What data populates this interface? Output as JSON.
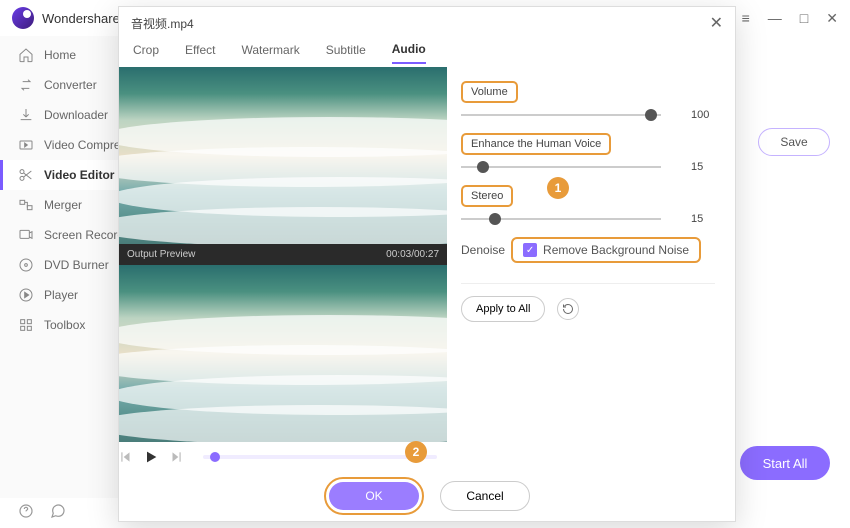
{
  "app": {
    "name": "Wondershare"
  },
  "window_controls": {
    "menu": "≡",
    "minimize": "—",
    "maximize": "□",
    "close": "✕"
  },
  "sidebar": {
    "items": [
      {
        "id": "home",
        "label": "Home"
      },
      {
        "id": "converter",
        "label": "Converter"
      },
      {
        "id": "downloader",
        "label": "Downloader"
      },
      {
        "id": "compress",
        "label": "Video Compress"
      },
      {
        "id": "editor",
        "label": "Video Editor"
      },
      {
        "id": "merger",
        "label": "Merger"
      },
      {
        "id": "recorder",
        "label": "Screen Recorde"
      },
      {
        "id": "burner",
        "label": "DVD Burner"
      },
      {
        "id": "player",
        "label": "Player"
      },
      {
        "id": "toolbox",
        "label": "Toolbox"
      }
    ]
  },
  "buttons": {
    "save": "Save",
    "start_all": "Start All",
    "ok": "OK",
    "cancel": "Cancel",
    "apply_all": "Apply to All"
  },
  "modal": {
    "filename": "音视频.mp4",
    "tabs": [
      "Crop",
      "Effect",
      "Watermark",
      "Subtitle",
      "Audio"
    ],
    "active_tab": "Audio",
    "preview": {
      "label": "Output Preview",
      "time": "00:03/00:27"
    },
    "audio": {
      "volume": {
        "label": "Volume",
        "value": "100",
        "pos": 92
      },
      "enhance": {
        "label": "Enhance the Human Voice",
        "value": "15",
        "pos": 8
      },
      "stereo": {
        "label": "Stereo",
        "value": "15",
        "pos": 14
      },
      "denoise": {
        "label": "Denoise",
        "checkbox_label": "Remove Background Noise",
        "checked": true
      }
    },
    "callouts": {
      "one": "1",
      "two": "2"
    }
  }
}
